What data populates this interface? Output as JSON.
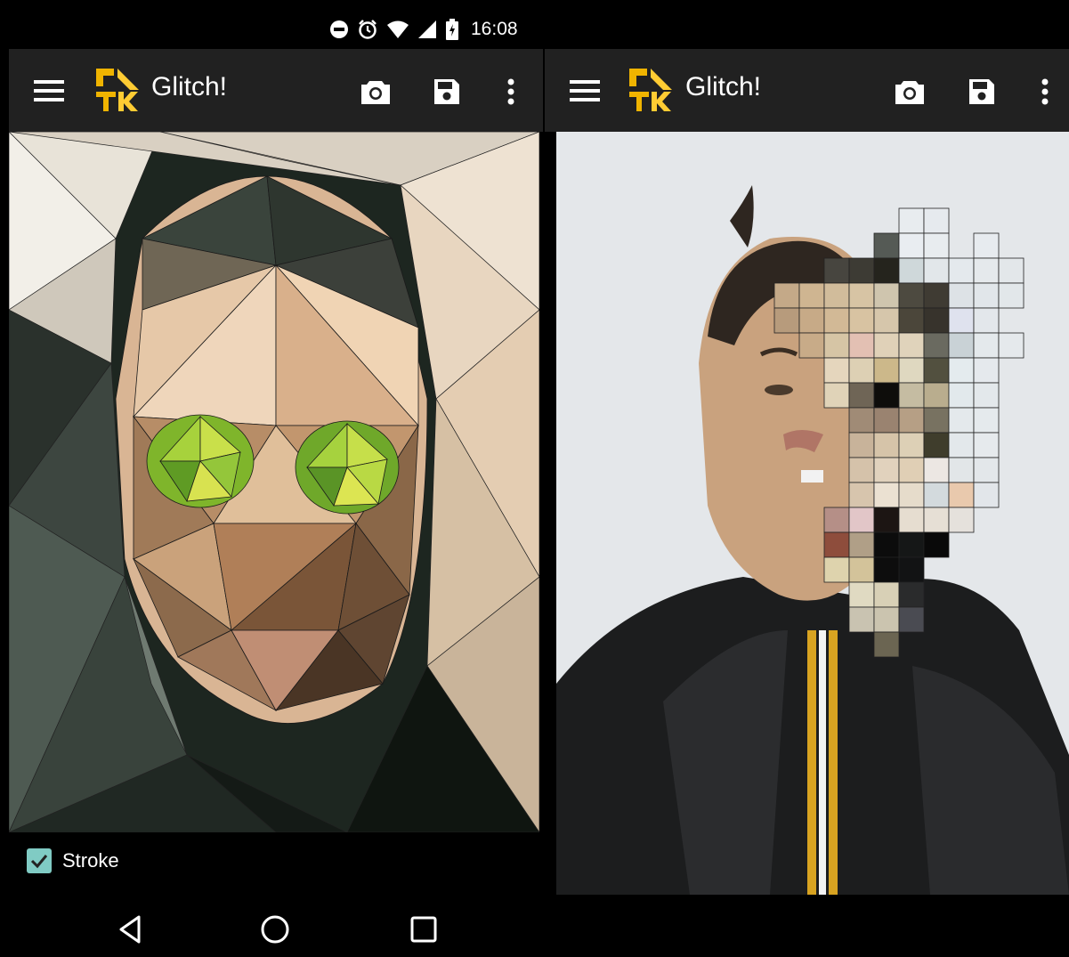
{
  "status_bar": {
    "time": "16:08",
    "icons": [
      "do-not-disturb-icon",
      "alarm-icon",
      "wifi-icon",
      "signal-icon",
      "battery-icon"
    ]
  },
  "left_screen": {
    "app_title": "Glitch!",
    "logo_colors": [
      "#f0b400",
      "#ffcc33"
    ],
    "actions": [
      "menu-icon",
      "camera-icon",
      "save-icon",
      "more-vert-icon"
    ],
    "image_description": "low-poly triangulated portrait effect",
    "checkbox": {
      "label": "Stroke",
      "checked": true
    },
    "accent": "#80cbc4"
  },
  "right_screen": {
    "app_title": "Glitch!",
    "actions": [
      "menu-icon",
      "camera-icon",
      "save-icon",
      "more-vert-icon"
    ],
    "image_description": "pixelated mosaic portrait effect"
  },
  "nav_bar": {
    "buttons": [
      "back-icon",
      "home-icon",
      "recents-icon"
    ]
  },
  "colors": {
    "toolbar": "#212121",
    "background": "#000000",
    "canvas_right_bg": "#e4e7ea"
  }
}
